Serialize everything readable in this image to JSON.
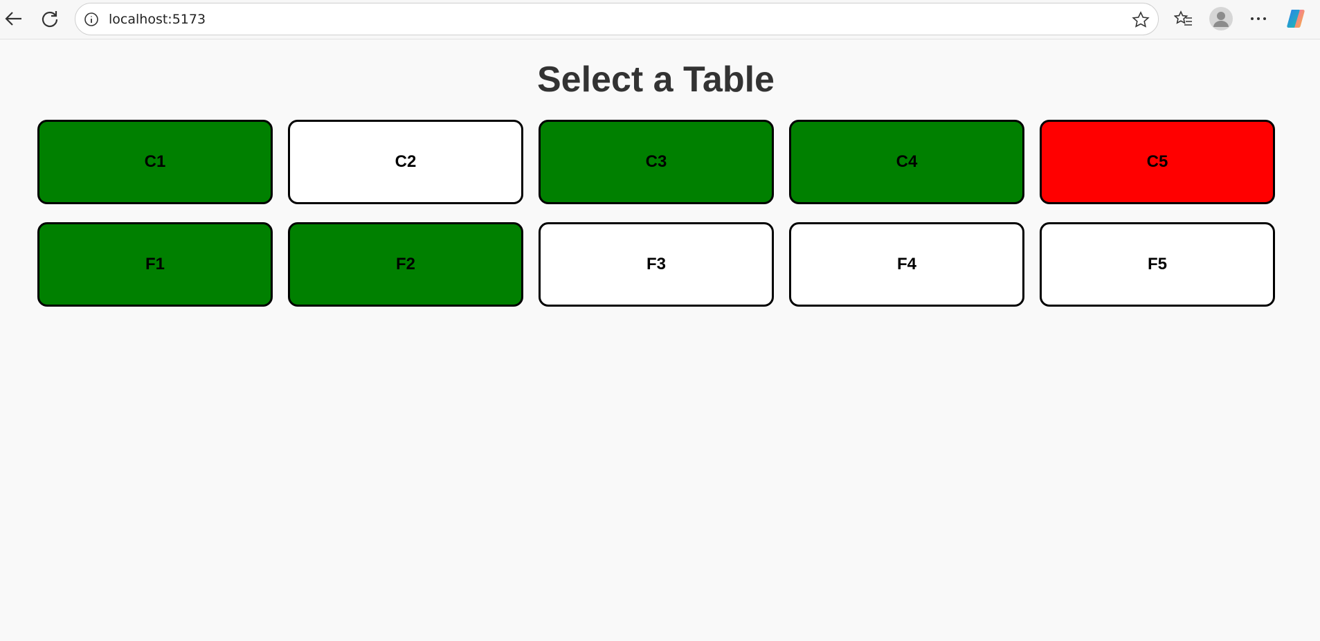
{
  "browser": {
    "url": "localhost:5173",
    "icons": [
      "back-arrow-icon",
      "refresh-icon",
      "site-info-icon",
      "favorite-star-icon",
      "favorites-icon",
      "profile-avatar-icon",
      "more-options-icon",
      "copilot-icon"
    ]
  },
  "page": {
    "title": "Select a Table"
  },
  "colors": {
    "occupied": "#008000",
    "available": "#ffffff",
    "reserved": "#ff0000"
  },
  "tables": [
    {
      "label": "C1",
      "color": "#008000"
    },
    {
      "label": "C2",
      "color": "#ffffff"
    },
    {
      "label": "C3",
      "color": "#008000"
    },
    {
      "label": "C4",
      "color": "#008000"
    },
    {
      "label": "C5",
      "color": "#ff0000"
    },
    {
      "label": "F1",
      "color": "#008000"
    },
    {
      "label": "F2",
      "color": "#008000"
    },
    {
      "label": "F3",
      "color": "#ffffff"
    },
    {
      "label": "F4",
      "color": "#ffffff"
    },
    {
      "label": "F5",
      "color": "#ffffff"
    }
  ]
}
